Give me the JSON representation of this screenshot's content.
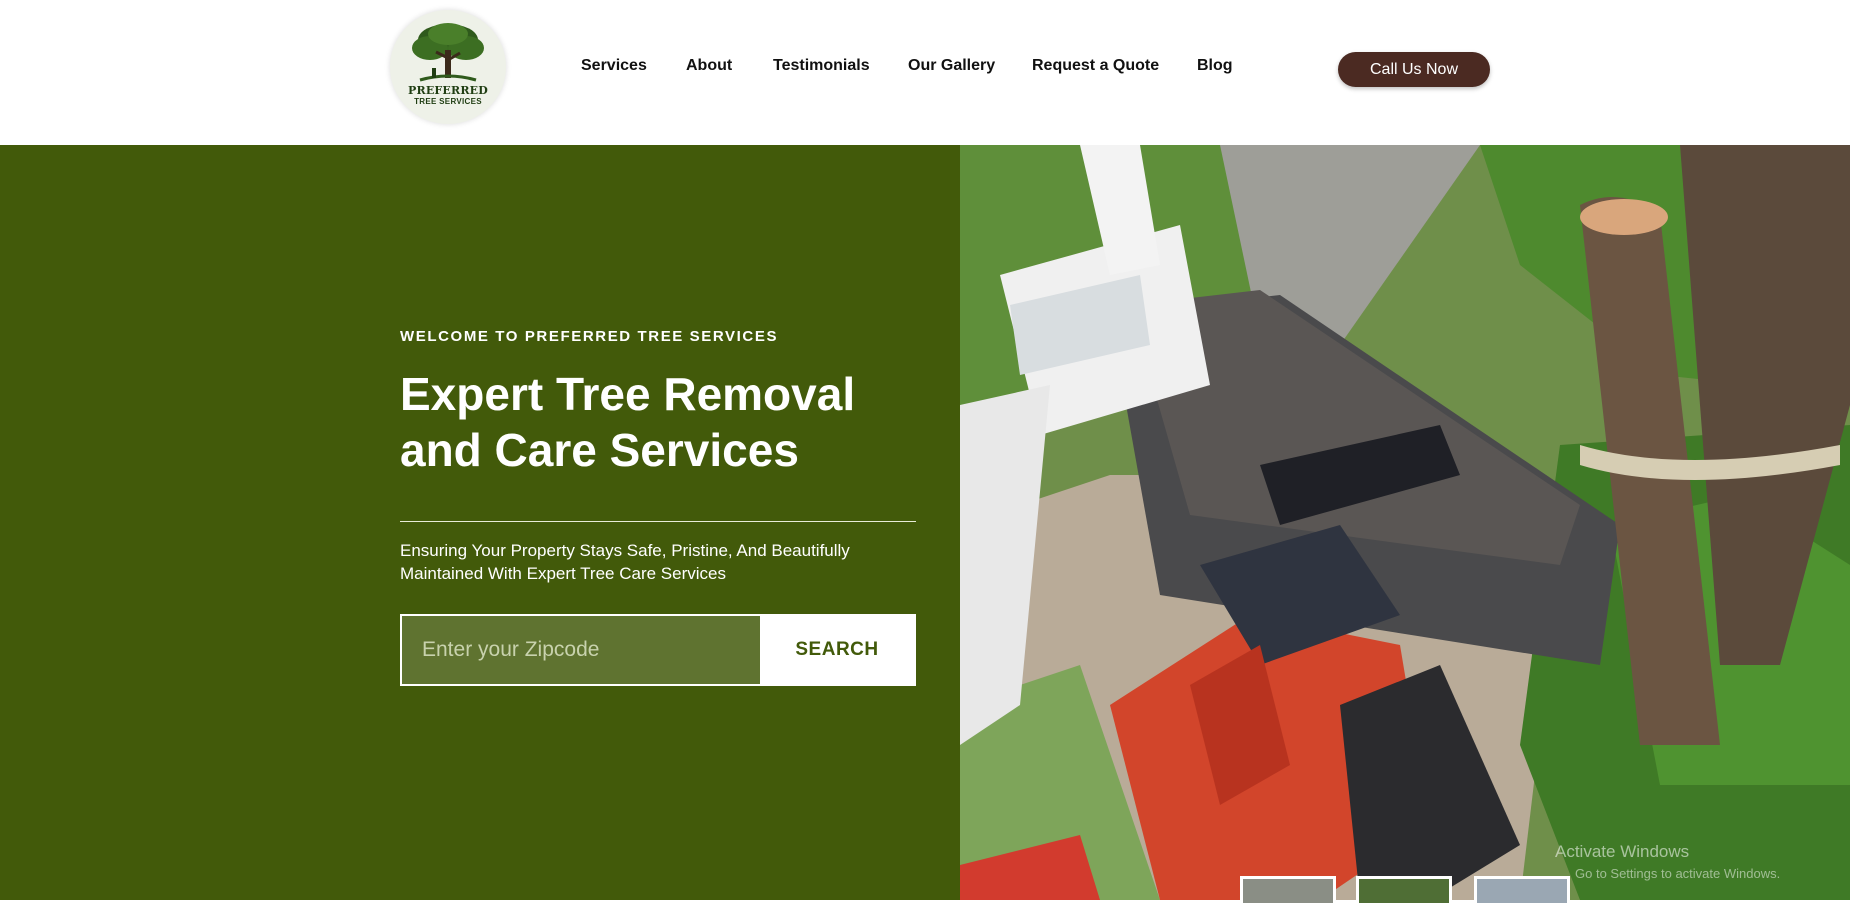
{
  "brand": {
    "name_line1": "PREFERRED",
    "name_line2": "TREE SERVICES",
    "logo_icon": "tree-icon"
  },
  "nav": {
    "items": [
      {
        "label": "Services"
      },
      {
        "label": "About"
      },
      {
        "label": "Testimonials"
      },
      {
        "label": "Our Gallery"
      },
      {
        "label": "Request a Quote"
      },
      {
        "label": "Blog"
      }
    ],
    "cta_label": "Call Us Now"
  },
  "hero": {
    "eyebrow": "WELCOME TO PREFERRED TREE SERVICES",
    "headline": "Expert Tree Removal and Care Services",
    "subtext": "Ensuring Your Property Stays Safe, Pristine, And Beautifully Maintained With Expert Tree Care Services",
    "search": {
      "placeholder": "Enter your Zipcode",
      "value": "",
      "button_label": "SEARCH"
    }
  },
  "overlay": {
    "watermark_title": "Activate Windows",
    "watermark_sub": "Go to Settings to activate Windows."
  },
  "colors": {
    "hero_green": "#425a0a",
    "cta_brown": "#4b2a22",
    "input_green": "#5f7330"
  }
}
